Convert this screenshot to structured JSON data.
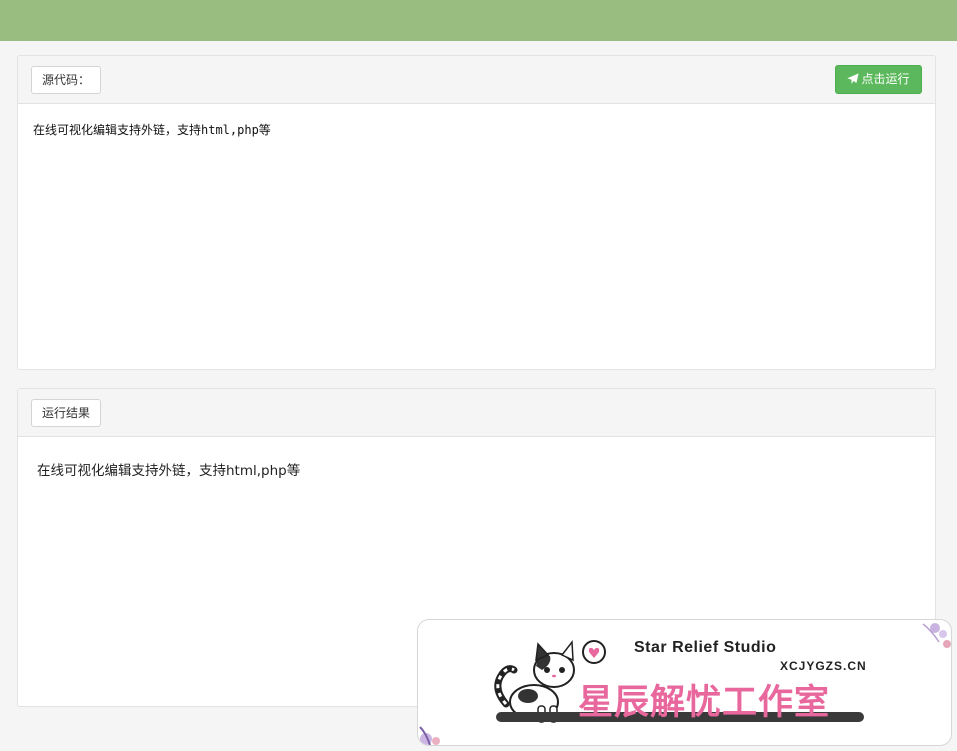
{
  "source_panel": {
    "label": "源代码：",
    "run_button": "点击运行",
    "code": "在线可视化编辑支持外链，支持html,php等"
  },
  "result_panel": {
    "label": "运行结果",
    "output": "在线可视化编辑支持外链，支持html,php等"
  },
  "ad_banner": {
    "title_en": "Star Relief Studio",
    "domain": "XCJYGZS.CN",
    "title_cn": "星辰解忧工作室"
  },
  "colors": {
    "topbar": "#99bd80",
    "run_button": "#5cb85c",
    "brand_pink": "#e8679c"
  }
}
